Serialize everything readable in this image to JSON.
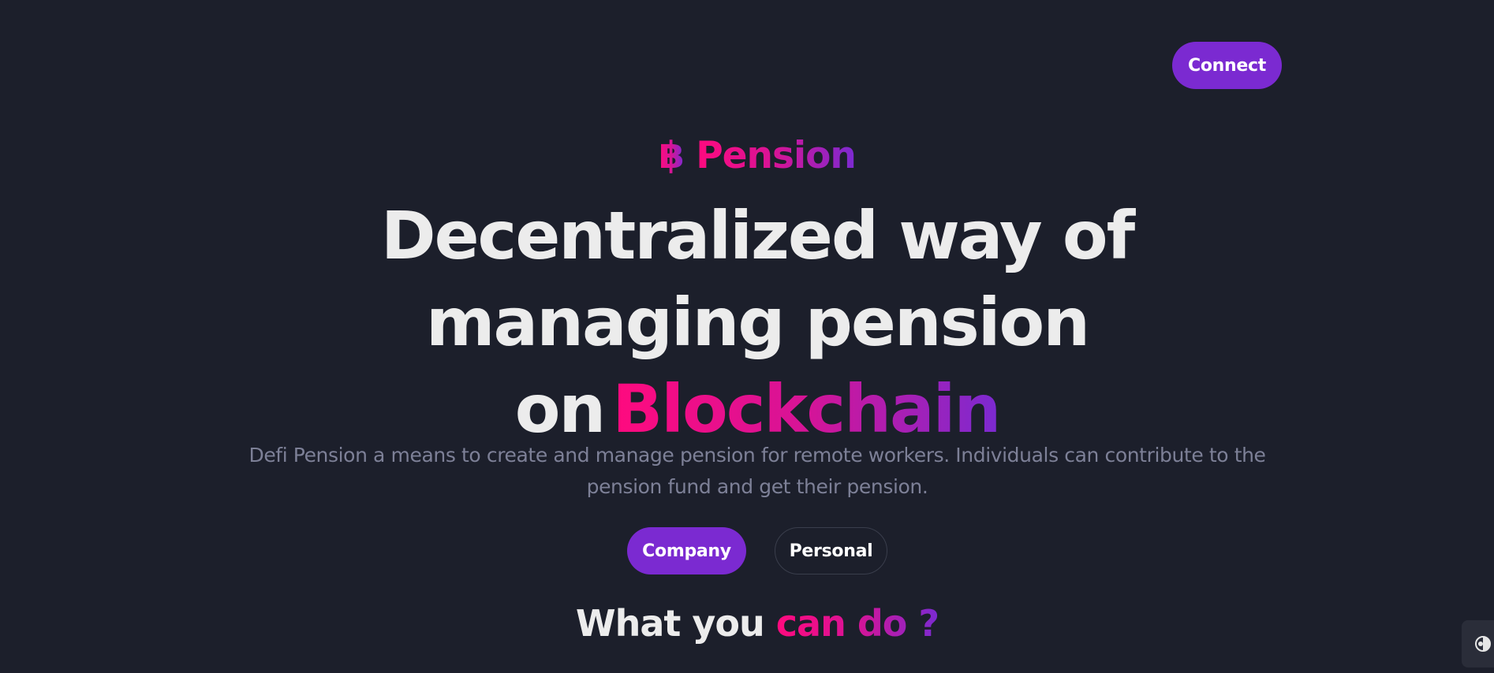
{
  "header": {
    "logo_icon": "soundwave-logo-icon",
    "connect_label": "Connect"
  },
  "hero": {
    "brand_symbol": "฿",
    "brand_name": "Pension",
    "headline_line1": "Decentralized way of",
    "headline_line2": "managing pension",
    "headline_line3_prefix": "on",
    "headline_accent": "Blockchain",
    "description": "Defi Pension a means to create and manage pension for remote workers. Individuals can contribute to the pension fund and get their pension.",
    "company_label": "Company",
    "personal_label": "Personal"
  },
  "section": {
    "title_prefix": "What you ",
    "title_accent": "can do ?"
  },
  "theme_toggle": {
    "icon": "contrast-icon"
  },
  "colors": {
    "background": "#1c1f2b",
    "accent_purple": "#7b2ad1",
    "accent_pink": "#ff0a7e",
    "headline": "#ececec",
    "muted_text": "#7d8097"
  }
}
